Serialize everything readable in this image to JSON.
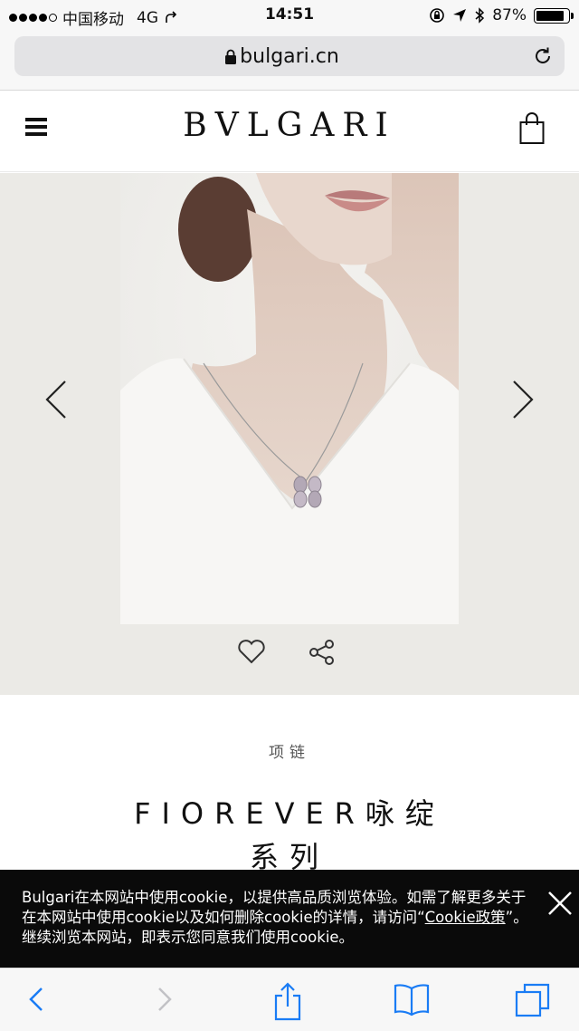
{
  "status_bar": {
    "carrier": "中国移动",
    "network": "4G",
    "time": "14:51",
    "battery_percent": "87%",
    "battery_level": 0.87
  },
  "browser": {
    "url": "bulgari.cn"
  },
  "site": {
    "logo": "BVLGARI"
  },
  "product": {
    "category": "项链",
    "title_line1": "FIOREVER咏绽",
    "title_line2": "系列"
  },
  "cookie_banner": {
    "text_before_link": "Bulgari在本网站中使用cookie，以提供高品质浏览体验。如需了解更多关于在本网站中使用cookie以及如何删除cookie的详情，请访问“",
    "link_text": "Cookie政策",
    "text_after_link": "”。继续浏览本网站，即表示您同意我们使用cookie。"
  },
  "colors": {
    "carousel_bg": "#ebeae6",
    "cookie_bg": "#0a0a0a",
    "ios_blue": "#1a7cf5"
  },
  "icons": [
    "lock-icon",
    "reload-icon",
    "menu-icon",
    "bag-icon",
    "chevron-left-icon",
    "chevron-right-icon",
    "heart-icon",
    "share-icon",
    "close-icon",
    "back-icon",
    "forward-icon",
    "share-sheet-icon",
    "bookmarks-icon",
    "tabs-icon"
  ]
}
